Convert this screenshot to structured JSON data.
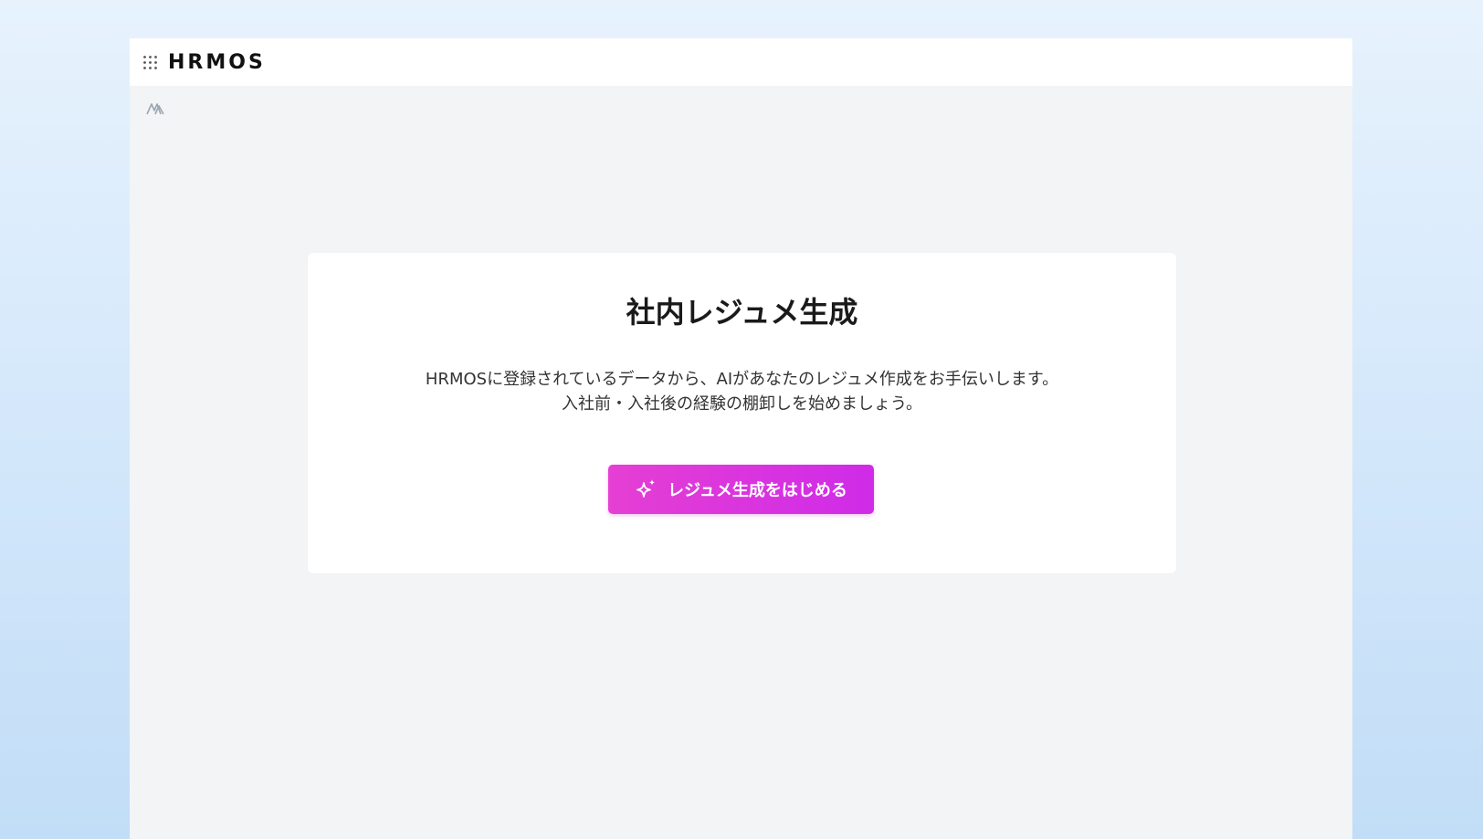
{
  "header": {
    "logo_text": "HRMOS",
    "apps_icon": "grid-dots-icon"
  },
  "sub_logo_icon": "hrmos-mark-icon",
  "card": {
    "title": "社内レジュメ生成",
    "description_line1": "HRMOSに登録されているデータから、AIがあなたのレジュメ作成をお手伝いします。",
    "description_line2": "入社前・入社後の経験の棚卸しを始めましょう。",
    "button_label": "レジュメ生成をはじめる",
    "button_icon": "sparkle-icon"
  },
  "colors": {
    "button_start": "#e53fd3",
    "button_end": "#cf2be8",
    "page_bg": "#f2f4f6",
    "header_bg": "#ffffff"
  }
}
